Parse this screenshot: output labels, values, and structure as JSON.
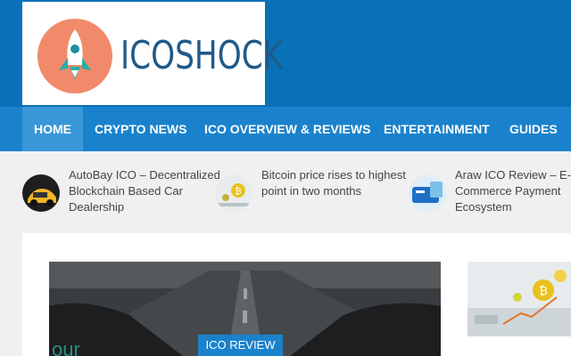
{
  "site": {
    "logo_text": "ICOSHOCK",
    "brand_color": "#0a71b8",
    "nav_color": "#1a82cc"
  },
  "nav": {
    "items": [
      {
        "label": "HOME",
        "active": true
      },
      {
        "label": "CRYPTO NEWS"
      },
      {
        "label": "ICO OVERVIEW & REVIEWS"
      },
      {
        "label": "ENTERTAINMENT"
      },
      {
        "label": "GUIDES"
      }
    ]
  },
  "ticker": {
    "items": [
      {
        "title": "AutoBay ICO – Decentralized Blockchain Based Car Dealership",
        "icon": "car-thumbnail"
      },
      {
        "title": "Bitcoin price rises to highest point in two months",
        "icon": "bitcoin-thumbnail"
      },
      {
        "title": "Araw ICO Review – E-Commerce Payment Ecosystem",
        "icon": "araw-card-thumbnail"
      }
    ]
  },
  "feature": {
    "badge": "ICO REVIEW",
    "overlay_text": "our"
  },
  "logo_icon": "rocket-icon"
}
